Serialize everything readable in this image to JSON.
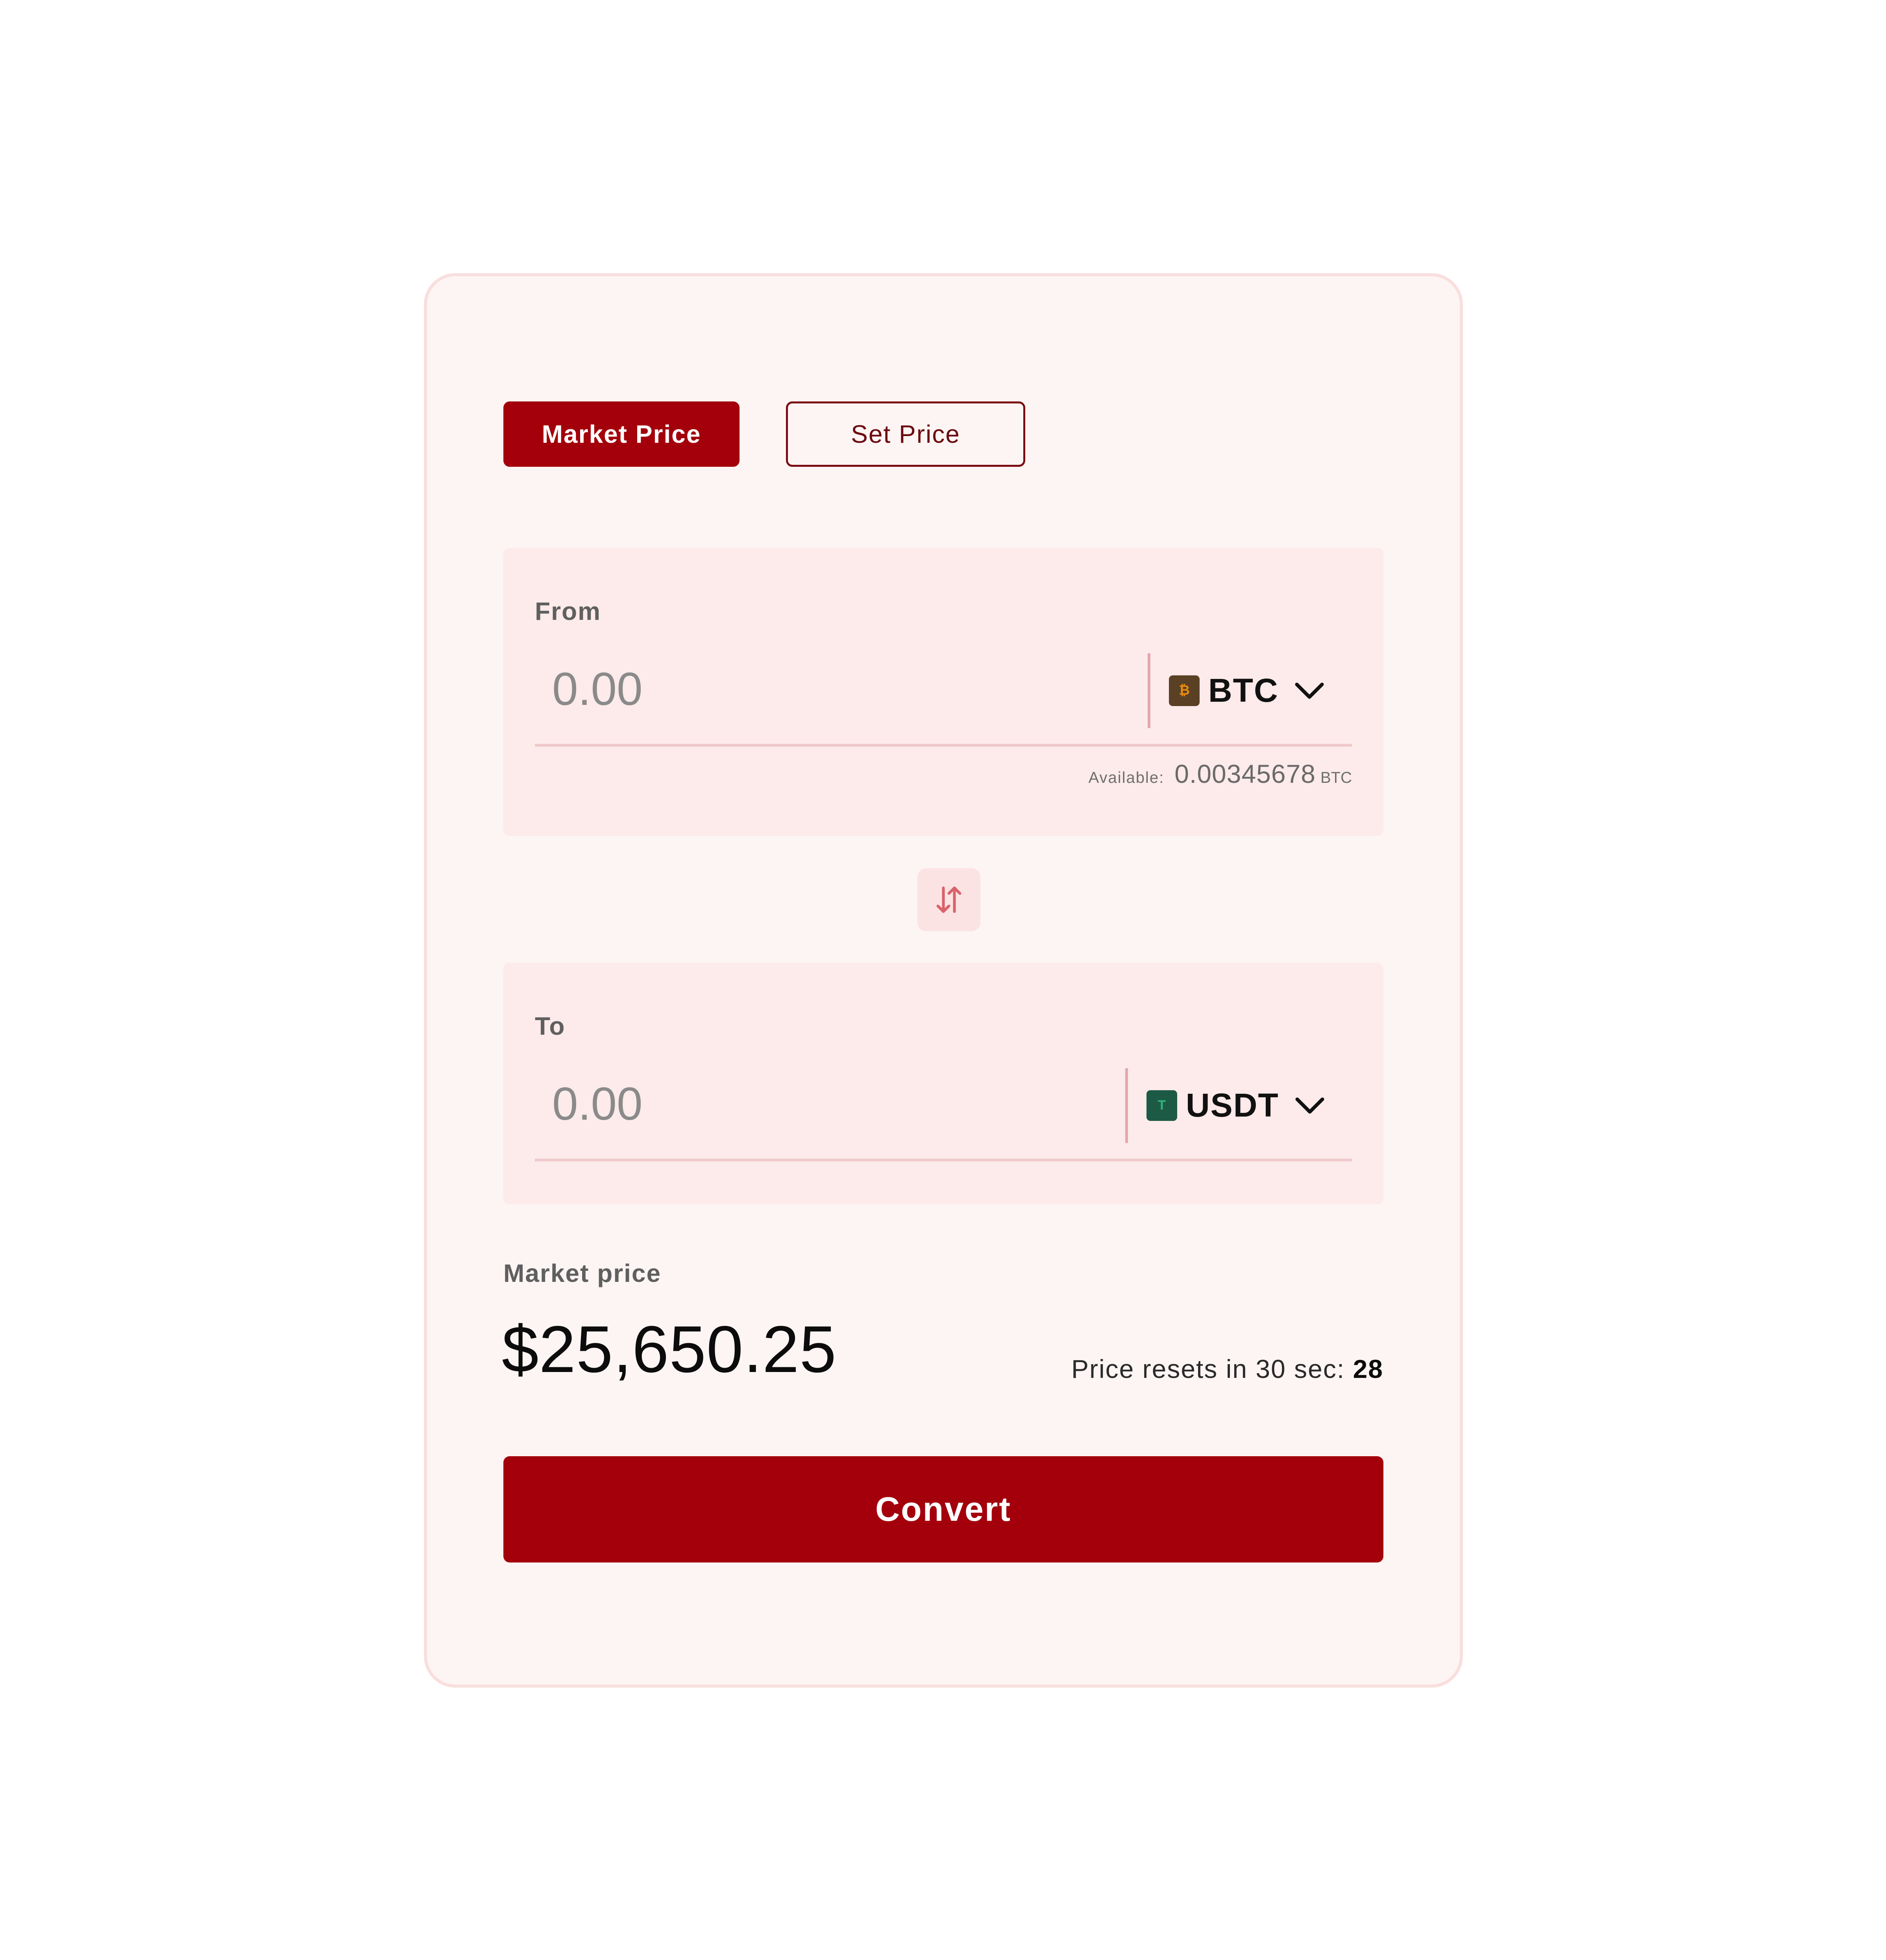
{
  "tabs": {
    "market_label": "Market Price",
    "set_label": "Set Price"
  },
  "from": {
    "label": "From",
    "placeholder": "0.00",
    "coin": "BTC",
    "coin_icon": "bitcoin-icon",
    "available_label": "Available:",
    "available_value": "0.00345678",
    "available_unit": "BTC"
  },
  "to": {
    "label": "To",
    "placeholder": "0.00",
    "coin": "USDT",
    "coin_icon": "tether-icon"
  },
  "swap_icon": "swap-vertical-icon",
  "market": {
    "label": "Market price",
    "value": "$25,650.25",
    "reset_text": "Price resets in 30 sec:",
    "reset_count": "28"
  },
  "convert_label": "Convert",
  "colors": {
    "accent": "#a3000b",
    "card_bg": "#fdf5f4",
    "panel_bg": "#fdeaea",
    "btc_icon": "#5a4024",
    "usdt_icon": "#1d5a45"
  }
}
